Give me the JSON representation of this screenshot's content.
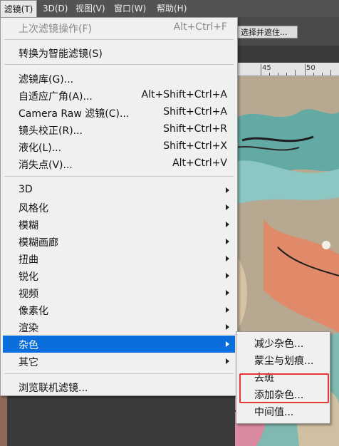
{
  "menubar": {
    "items": [
      {
        "label": "滤镜(T)",
        "active": true
      },
      {
        "label": "3D(D)"
      },
      {
        "label": "视图(V)"
      },
      {
        "label": "窗口(W)"
      },
      {
        "label": "帮助(H)"
      }
    ]
  },
  "options_bar": {
    "button_label": "选择并遮住..."
  },
  "ruler": {
    "labels": [
      "45",
      "50"
    ]
  },
  "filter_menu": {
    "last_filter": {
      "label": "上次滤镜操作(F)",
      "shortcut": "Alt+Ctrl+F",
      "enabled": false
    },
    "smart_filter": {
      "label": "转换为智能滤镜(S)"
    },
    "group1": [
      {
        "label": "滤镜库(G)...",
        "shortcut": ""
      },
      {
        "label": "自适应广角(A)...",
        "shortcut": "Alt+Shift+Ctrl+A"
      },
      {
        "label": "Camera Raw 滤镜(C)...",
        "shortcut": "Shift+Ctrl+A"
      },
      {
        "label": "镜头校正(R)...",
        "shortcut": "Shift+Ctrl+R"
      },
      {
        "label": "液化(L)...",
        "shortcut": "Shift+Ctrl+X"
      },
      {
        "label": "消失点(V)...",
        "shortcut": "Alt+Ctrl+V"
      }
    ],
    "submenus": [
      {
        "label": "3D"
      },
      {
        "label": "风格化"
      },
      {
        "label": "模糊"
      },
      {
        "label": "模糊画廊"
      },
      {
        "label": "扭曲"
      },
      {
        "label": "锐化"
      },
      {
        "label": "视频"
      },
      {
        "label": "像素化"
      },
      {
        "label": "渲染"
      },
      {
        "label": "杂色",
        "highlighted": true
      },
      {
        "label": "其它"
      }
    ],
    "browse_online": {
      "label": "浏览联机滤镜..."
    }
  },
  "noise_submenu": {
    "items": [
      {
        "label": "减少杂色..."
      },
      {
        "label": "蒙尘与划痕..."
      },
      {
        "label": "去斑"
      },
      {
        "label": "添加杂色..."
      },
      {
        "label": "中间值..."
      }
    ],
    "annotation": "red rectangle around 去斑 / 添加杂色..."
  },
  "colors": {
    "highlight": "#0a6fdc",
    "menu_bg": "#f0f0f0",
    "annotation_red": "#e53935"
  }
}
